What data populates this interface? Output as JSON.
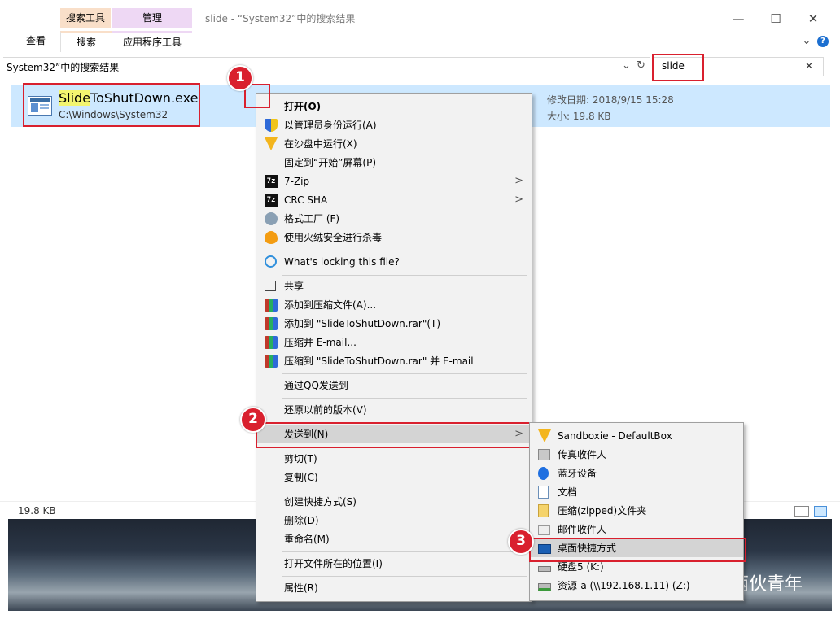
{
  "window": {
    "title": "slide - “System32”中的搜索结果",
    "context_tabs": [
      "搜索工具",
      "管理"
    ],
    "ribbon_tabs": [
      "查看",
      "搜索",
      "应用程序工具"
    ],
    "controls": {
      "minimize": "—",
      "maximize": "☐",
      "close": "✕",
      "expand": "⌄",
      "help": "?"
    }
  },
  "address": {
    "text": "System32”中的搜索结果",
    "dropdown": "⌄",
    "refresh": "↻"
  },
  "search": {
    "value": "slide",
    "clear": "✕"
  },
  "file": {
    "name_highlight": "Slide",
    "name_rest": "ToShutDown.exe",
    "path": "C:\\Windows\\System32",
    "modified": "修改日期: 2018/9/15 15:28",
    "size": "大小: 19.8 KB"
  },
  "status": {
    "size": "19.8 KB"
  },
  "context_menu": {
    "open": "打开(O)",
    "run_as_admin": "以管理员身份运行(A)",
    "sandbox": "在沙盘中运行(X)",
    "pin_start": "固定到“开始”屏幕(P)",
    "zip7": "7-Zip",
    "crc": "CRC SHA",
    "format_factory": "格式工厂 (F)",
    "huorong": "使用火绒安全进行杀毒",
    "locking": "What's locking this file?",
    "share": "共享",
    "add_archive": "添加到压缩文件(A)...",
    "add_rar": "添加到 \"SlideToShutDown.rar\"(T)",
    "compress_email": "压缩并 E-mail...",
    "compress_rar_email": "压缩到 \"SlideToShutDown.rar\" 并 E-mail",
    "send_qq": "通过QQ发送到",
    "restore_prev": "还原以前的版本(V)",
    "send_to": "发送到(N)",
    "cut": "剪切(T)",
    "copy": "复制(C)",
    "create_shortcut": "创建快捷方式(S)",
    "delete": "删除(D)",
    "rename": "重命名(M)",
    "open_location": "打开文件所在的位置(I)",
    "properties": "属性(R)"
  },
  "sendto_menu": {
    "sandboxie": "Sandboxie - DefaultBox",
    "fax": "传真收件人",
    "bluetooth": "蓝牙设备",
    "documents": "文档",
    "zip_folder": "压缩(zipped)文件夹",
    "mail": "邮件收件人",
    "desktop_shortcut": "桌面快捷方式",
    "disk5": "硬盘5 (K:)",
    "network": "资源-a (\\\\192.168.1.11) (Z:)"
  },
  "annotations": [
    "1",
    "2",
    "3"
  ],
  "watermark": "两伙青年"
}
